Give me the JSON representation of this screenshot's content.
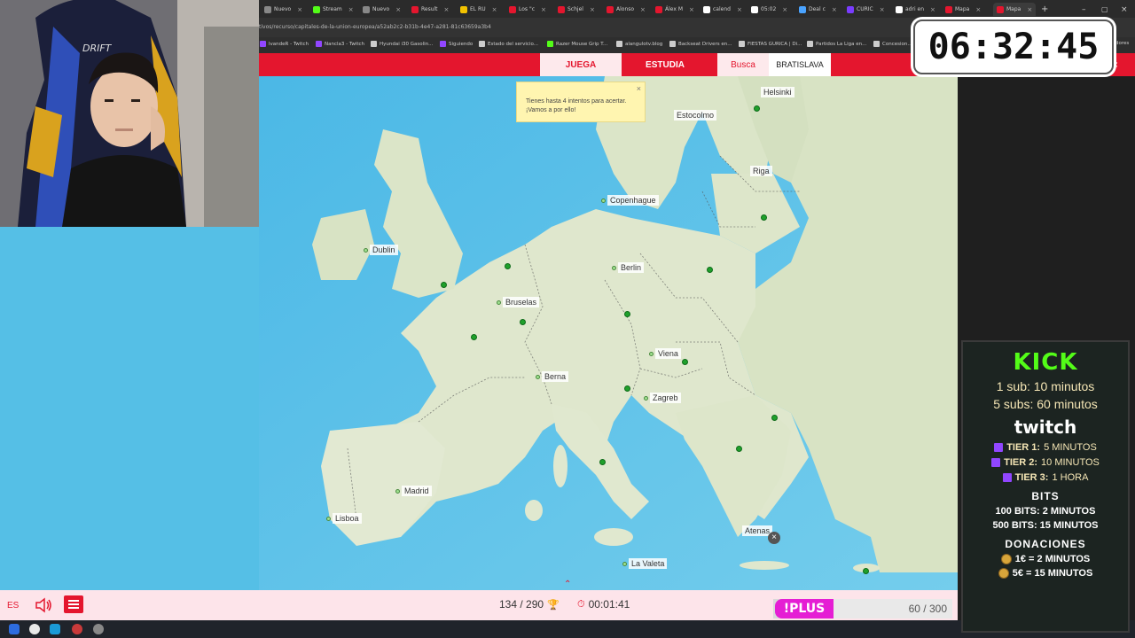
{
  "browser": {
    "tabs": [
      {
        "label": "Nuevo",
        "color": "#888888"
      },
      {
        "label": "Stream",
        "color": "#53fc18"
      },
      {
        "label": "Nuevo",
        "color": "#888888"
      },
      {
        "label": "Result",
        "color": "#e4162e"
      },
      {
        "label": "EL RU",
        "color": "#f2c200"
      },
      {
        "label": "Los \"c",
        "color": "#e4162e"
      },
      {
        "label": "Schjel",
        "color": "#e4162e"
      },
      {
        "label": "Alonso",
        "color": "#e4162e"
      },
      {
        "label": "Álex M",
        "color": "#e4162e"
      },
      {
        "label": "calend",
        "color": "#ffffff"
      },
      {
        "label": "05:02",
        "color": "#ffffff"
      },
      {
        "label": "Deal c",
        "color": "#4aa3ff"
      },
      {
        "label": "CURIC",
        "color": "#7a3cff"
      },
      {
        "label": "adri en",
        "color": "#ffffff"
      },
      {
        "label": "Mapa",
        "color": "#e4162e"
      },
      {
        "label": "Mapa",
        "color": "#e4162e"
      }
    ],
    "url": "tivos/recurso/capitales-de-la-union-europea/a52ab2c2-b31b-4e47-a281-81c63659a3b4",
    "bookmarks": [
      {
        "label": "lvandeR - Twitch",
        "color": "#9146ff"
      },
      {
        "label": "Nancla3 - Twitch",
        "color": "#9146ff"
      },
      {
        "label": "Hyundai i30 Gasolin...",
        "color": "#cccccc"
      },
      {
        "label": "Siguiendo",
        "color": "#9146ff"
      },
      {
        "label": "Estado del servicio...",
        "color": "#cccccc"
      },
      {
        "label": "Razer Mouse Grip T...",
        "color": "#53fc18"
      },
      {
        "label": "alangulotv.blog",
        "color": "#cccccc"
      },
      {
        "label": "Backseat Drivers en...",
        "color": "#cccccc"
      },
      {
        "label": "FIESTAS GURICA | Di...",
        "color": "#cccccc"
      },
      {
        "label": "Partidos La Liga en...",
        "color": "#cccccc"
      },
      {
        "label": "Concesion...",
        "color": "#cccccc"
      },
      {
        "label": "dores",
        "color": "#cccccc"
      }
    ]
  },
  "nav": {
    "play": "JUEGA",
    "study": "ESTUDIA",
    "find": "Busca",
    "target": "BRATISLAVA",
    "close": "×"
  },
  "tooltip": {
    "text": "Tienes hasta 4 intentos para acertar. ¡Vamos a por ello!",
    "close": "×"
  },
  "cities": [
    {
      "name": "Helsinki"
    },
    {
      "name": "Estocolmo"
    },
    {
      "name": "Riga"
    },
    {
      "name": "Copenhague"
    },
    {
      "name": "Dublin"
    },
    {
      "name": "Berlin"
    },
    {
      "name": "Bruselas"
    },
    {
      "name": "Viena"
    },
    {
      "name": "Berna"
    },
    {
      "name": "Zagreb"
    },
    {
      "name": "Madrid"
    },
    {
      "name": "Lisboa"
    },
    {
      "name": "Atenas"
    },
    {
      "name": "La Valeta"
    }
  ],
  "bottom": {
    "lang": "ES",
    "score": "134 / 290",
    "timer": "00:01:41",
    "plus_label": "!PLUS",
    "plus_count": "60 / 300",
    "plus_progress": 0.2
  },
  "clock": "06:32:45",
  "subs": {
    "kick_title": "KICK",
    "kick_lines": [
      "1 sub: 10 minutos",
      "5 subs: 60 minutos"
    ],
    "twitch_title": "twitch",
    "tiers": [
      {
        "tier": "TIER 1:",
        "value": "5 MINUTOS"
      },
      {
        "tier": "TIER 2:",
        "value": "10 MINUTOS"
      },
      {
        "tier": "TIER 3:",
        "value": "1 HORA"
      }
    ],
    "bits_title": "BITS",
    "bits_lines": [
      "100 BITS: 2 MINUTOS",
      "500 BITS: 15 MINUTOS"
    ],
    "donations_title": "DONACIONES",
    "donation_lines": [
      "1€ = 2 MINUTOS",
      "5€ = 15 MINUTOS"
    ]
  }
}
